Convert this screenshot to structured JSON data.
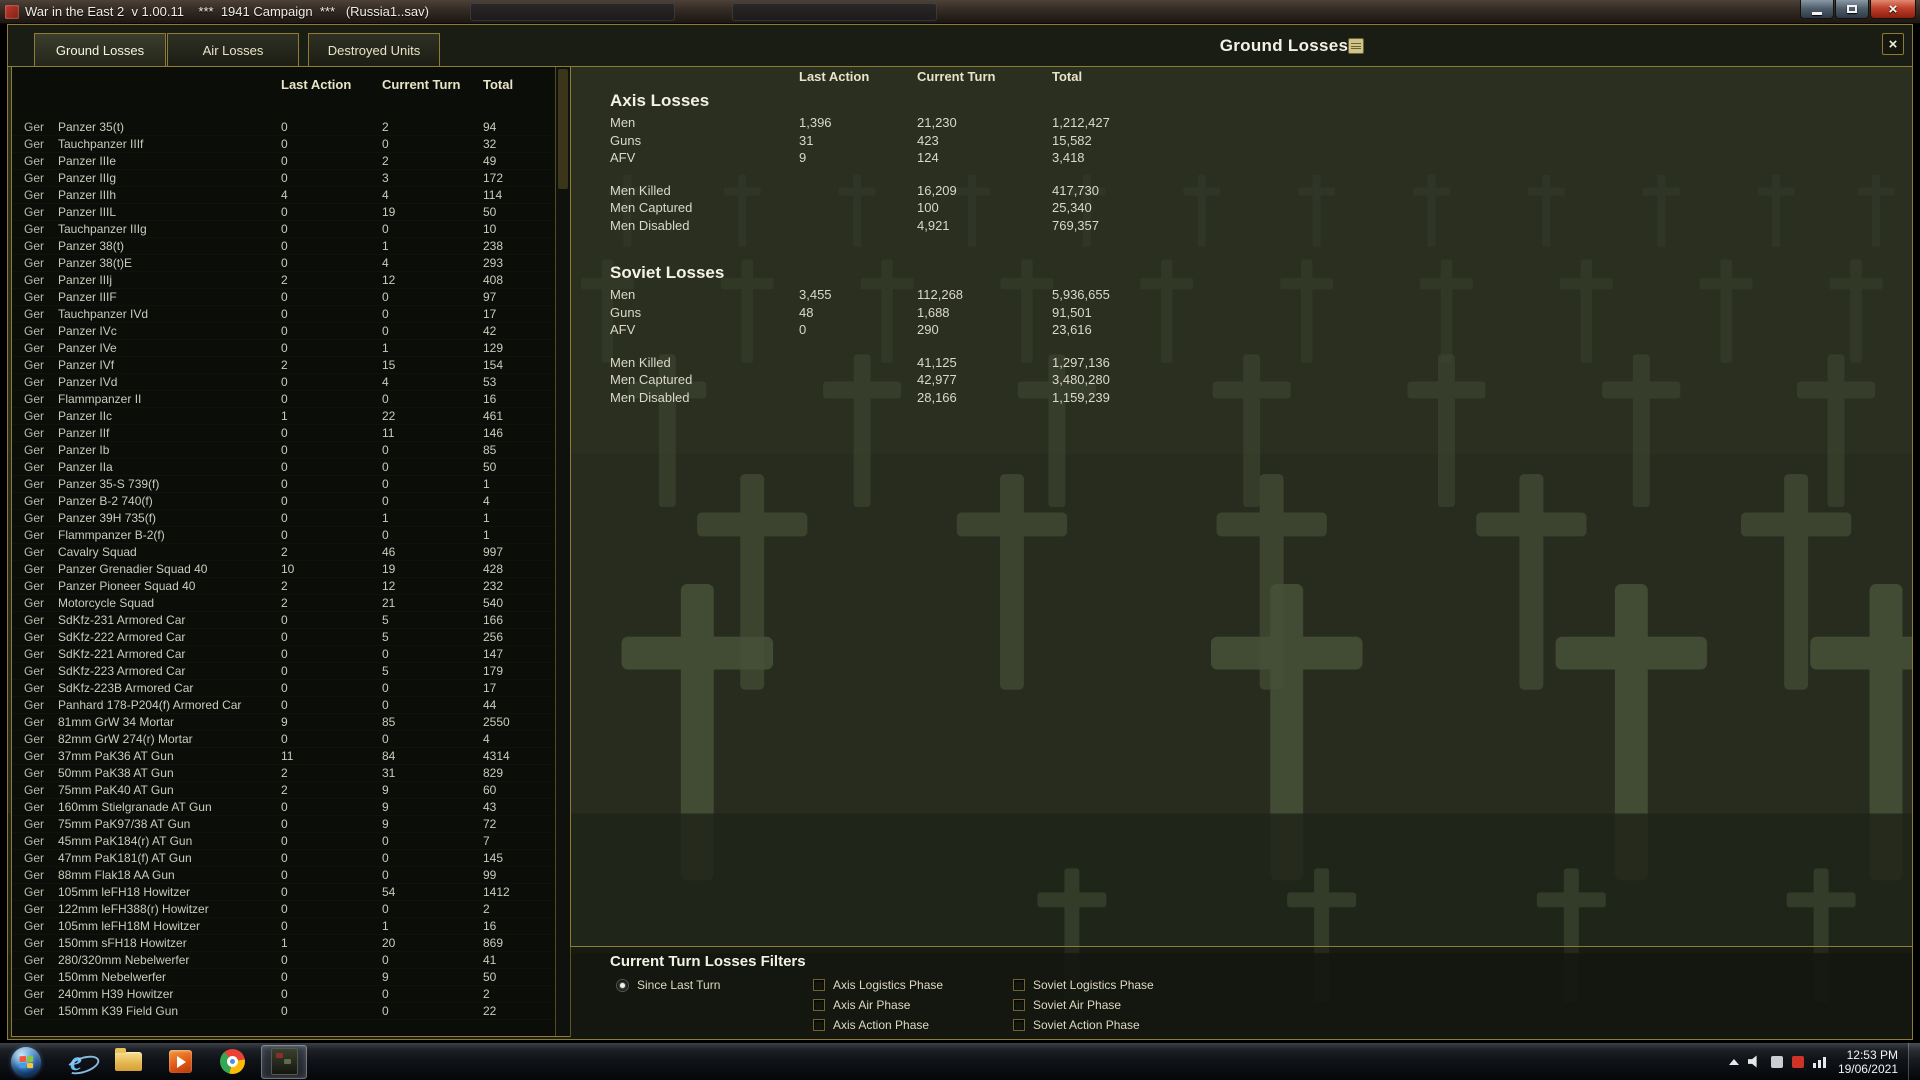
{
  "titlebar": {
    "title": "War in the East 2  v 1.00.11    ***  1941 Campaign  ***   (Russia1..sav)"
  },
  "page_title": "Ground Losses",
  "tabs": [
    {
      "label": "Ground Losses",
      "active": true
    },
    {
      "label": "Air Losses",
      "active": false
    },
    {
      "label": "Destroyed Units",
      "active": false
    }
  ],
  "unit_table": {
    "col_headers": [
      "Last Action",
      "Current Turn",
      "Total"
    ],
    "rows": [
      [
        "Ger",
        "Panzer 35(t)",
        "0",
        "2",
        "94"
      ],
      [
        "Ger",
        "Tauchpanzer IIIf",
        "0",
        "0",
        "32"
      ],
      [
        "Ger",
        "Panzer IIIe",
        "0",
        "2",
        "49"
      ],
      [
        "Ger",
        "Panzer IIIg",
        "0",
        "3",
        "172"
      ],
      [
        "Ger",
        "Panzer IIIh",
        "4",
        "4",
        "114"
      ],
      [
        "Ger",
        "Panzer IIIL",
        "0",
        "19",
        "50"
      ],
      [
        "Ger",
        "Tauchpanzer IIIg",
        "0",
        "0",
        "10"
      ],
      [
        "Ger",
        "Panzer 38(t)",
        "0",
        "1",
        "238"
      ],
      [
        "Ger",
        "Panzer 38(t)E",
        "0",
        "4",
        "293"
      ],
      [
        "Ger",
        "Panzer IIIj",
        "2",
        "12",
        "408"
      ],
      [
        "Ger",
        "Panzer IIIF",
        "0",
        "0",
        "97"
      ],
      [
        "Ger",
        "Tauchpanzer IVd",
        "0",
        "0",
        "17"
      ],
      [
        "Ger",
        "Panzer IVc",
        "0",
        "0",
        "42"
      ],
      [
        "Ger",
        "Panzer IVe",
        "0",
        "1",
        "129"
      ],
      [
        "Ger",
        "Panzer IVf",
        "2",
        "15",
        "154"
      ],
      [
        "Ger",
        "Panzer IVd",
        "0",
        "4",
        "53"
      ],
      [
        "Ger",
        "Flammpanzer II",
        "0",
        "0",
        "16"
      ],
      [
        "Ger",
        "Panzer IIc",
        "1",
        "22",
        "461"
      ],
      [
        "Ger",
        "Panzer IIf",
        "0",
        "11",
        "146"
      ],
      [
        "Ger",
        "Panzer Ib",
        "0",
        "0",
        "85"
      ],
      [
        "Ger",
        "Panzer IIa",
        "0",
        "0",
        "50"
      ],
      [
        "Ger",
        "Panzer 35-S 739(f)",
        "0",
        "0",
        "1"
      ],
      [
        "Ger",
        "Panzer B-2 740(f)",
        "0",
        "0",
        "4"
      ],
      [
        "Ger",
        "Panzer 39H 735(f)",
        "0",
        "1",
        "1"
      ],
      [
        "Ger",
        "Flammpanzer B-2(f)",
        "0",
        "0",
        "1"
      ],
      [
        "Ger",
        "Cavalry Squad",
        "2",
        "46",
        "997"
      ],
      [
        "Ger",
        "Panzer Grenadier Squad 40",
        "10",
        "19",
        "428"
      ],
      [
        "Ger",
        "Panzer Pioneer Squad 40",
        "2",
        "12",
        "232"
      ],
      [
        "Ger",
        "Motorcycle Squad",
        "2",
        "21",
        "540"
      ],
      [
        "Ger",
        "SdKfz-231 Armored Car",
        "0",
        "5",
        "166"
      ],
      [
        "Ger",
        "SdKfz-222 Armored Car",
        "0",
        "5",
        "256"
      ],
      [
        "Ger",
        "SdKfz-221 Armored Car",
        "0",
        "0",
        "147"
      ],
      [
        "Ger",
        "SdKfz-223 Armored Car",
        "0",
        "5",
        "179"
      ],
      [
        "Ger",
        "SdKfz-223B Armored Car",
        "0",
        "0",
        "17"
      ],
      [
        "Ger",
        "Panhard 178-P204(f) Armored Car",
        "0",
        "0",
        "44"
      ],
      [
        "Ger",
        "81mm GrW 34 Mortar",
        "9",
        "85",
        "2550"
      ],
      [
        "Ger",
        "82mm GrW 274(r) Mortar",
        "0",
        "0",
        "4"
      ],
      [
        "Ger",
        "37mm PaK36 AT Gun",
        "11",
        "84",
        "4314"
      ],
      [
        "Ger",
        "50mm PaK38 AT Gun",
        "2",
        "31",
        "829"
      ],
      [
        "Ger",
        "75mm PaK40 AT Gun",
        "2",
        "9",
        "60"
      ],
      [
        "Ger",
        "160mm Stielgranade AT Gun",
        "0",
        "9",
        "43"
      ],
      [
        "Ger",
        "75mm PaK97/38 AT Gun",
        "0",
        "9",
        "72"
      ],
      [
        "Ger",
        "45mm PaK184(r) AT Gun",
        "0",
        "0",
        "7"
      ],
      [
        "Ger",
        "47mm PaK181(f) AT Gun",
        "0",
        "0",
        "145"
      ],
      [
        "Ger",
        "88mm Flak18 AA Gun",
        "0",
        "0",
        "99"
      ],
      [
        "Ger",
        "105mm leFH18 Howitzer",
        "0",
        "54",
        "1412"
      ],
      [
        "Ger",
        "122mm leFH388(r) Howitzer",
        "0",
        "0",
        "2"
      ],
      [
        "Ger",
        "105mm leFH18M Howitzer",
        "0",
        "1",
        "16"
      ],
      [
        "Ger",
        "150mm sFH18 Howitzer",
        "1",
        "20",
        "869"
      ],
      [
        "Ger",
        "280/320mm Nebelwerfer",
        "0",
        "0",
        "41"
      ],
      [
        "Ger",
        "150mm Nebelwerfer",
        "0",
        "9",
        "50"
      ],
      [
        "Ger",
        "240mm H39 Howitzer",
        "0",
        "0",
        "2"
      ],
      [
        "Ger",
        "150mm K39 Field Gun",
        "0",
        "0",
        "22"
      ]
    ]
  },
  "summary": {
    "col_headers": [
      "Last Action",
      "Current Turn",
      "Total"
    ],
    "groups": [
      {
        "title": "Axis Losses",
        "equipment_rows": [
          [
            "Men",
            "1,396",
            "21,230",
            "1,212,427"
          ],
          [
            "Guns",
            "31",
            "423",
            "15,582"
          ],
          [
            "AFV",
            "9",
            "124",
            "3,418"
          ]
        ],
        "casualty_rows": [
          [
            "Men Killed",
            "",
            "16,209",
            "417,730"
          ],
          [
            "Men Captured",
            "",
            "100",
            "25,340"
          ],
          [
            "Men Disabled",
            "",
            "4,921",
            "769,357"
          ]
        ]
      },
      {
        "title": "Soviet Losses",
        "equipment_rows": [
          [
            "Men",
            "3,455",
            "112,268",
            "5,936,655"
          ],
          [
            "Guns",
            "48",
            "1,688",
            "91,501"
          ],
          [
            "AFV",
            "0",
            "290",
            "23,616"
          ]
        ],
        "casualty_rows": [
          [
            "Men Killed",
            "",
            "41,125",
            "1,297,136"
          ],
          [
            "Men Captured",
            "",
            "42,977",
            "3,480,280"
          ],
          [
            "Men Disabled",
            "",
            "28,166",
            "1,159,239"
          ]
        ]
      }
    ]
  },
  "filters": {
    "title": "Current Turn Losses Filters",
    "radio": {
      "label": "Since Last Turn",
      "selected": true
    },
    "checkboxes": [
      {
        "label": "Axis Logistics Phase",
        "checked": false
      },
      {
        "label": "Axis Air Phase",
        "checked": false
      },
      {
        "label": "Axis Action Phase",
        "checked": false
      },
      {
        "label": "Soviet Logistics Phase",
        "checked": false
      },
      {
        "label": "Soviet Air Phase",
        "checked": false
      },
      {
        "label": "Soviet Action Phase",
        "checked": false
      }
    ]
  },
  "taskbar": {
    "items": [
      {
        "name": "start",
        "icon": "start-orb",
        "active": false
      },
      {
        "name": "internet-explorer",
        "icon": "ie",
        "active": false
      },
      {
        "name": "file-explorer",
        "icon": "folder",
        "active": false
      },
      {
        "name": "media-player",
        "icon": "media",
        "active": false
      },
      {
        "name": "chrome",
        "icon": "chrome",
        "active": false
      },
      {
        "name": "war-in-the-east-2",
        "icon": "game",
        "active": true
      }
    ],
    "tray_icons": [
      "chevron-up",
      "volume",
      "update",
      "app-red",
      "network"
    ],
    "clock": {
      "time": "12:53 PM",
      "date": "19/06/2021"
    }
  },
  "colors": {
    "gold_border": "#8f7b33",
    "panel_bg": "#0b0d08",
    "background_olive": "#272c1e",
    "text_cream": "#e9e4c8",
    "text_white": "#f4f2e6"
  }
}
